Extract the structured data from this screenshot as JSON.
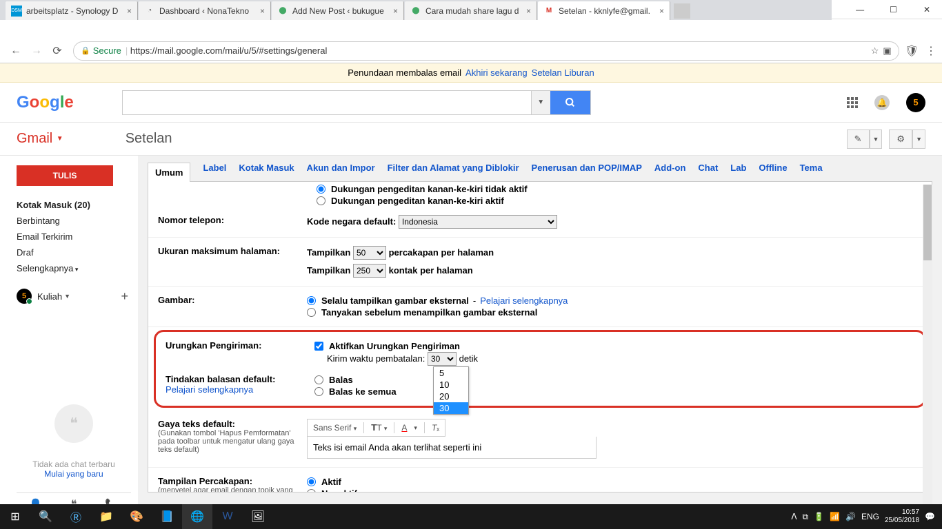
{
  "browser_tabs": [
    {
      "title": "arbeitsplatz - Synology D",
      "favicon": "DSM",
      "favicon_bg": "#0096d6"
    },
    {
      "title": "Dashboard ‹ NonaTekno",
      "favicon": "⬤",
      "favicon_bg": "#333"
    },
    {
      "title": "Add New Post ‹ bukugue",
      "favicon": "⬤",
      "favicon_bg": "#4a6"
    },
    {
      "title": "Cara mudah share lagu d",
      "favicon": "⬤",
      "favicon_bg": "#4a6"
    },
    {
      "title": "Setelan - kknlyfe@gmail.",
      "favicon": "M",
      "favicon_bg": "#d93025",
      "active": true
    }
  ],
  "address": {
    "secure": "Secure",
    "url": "https://mail.google.com/mail/u/5/#settings/general"
  },
  "banner": {
    "text": "Penundaan membalas email",
    "link1": "Akhiri sekarang",
    "link2": "Setelan Liburan"
  },
  "header": {
    "avatar_badge": "5"
  },
  "subheader": {
    "brand": "Gmail",
    "title": "Setelan"
  },
  "sidebar": {
    "compose": "TULIS",
    "items": [
      "Kotak Masuk (20)",
      "Berbintang",
      "Email Terkirim",
      "Draf",
      "Selengkapnya"
    ],
    "label_name": "Kuliah",
    "label_badge": "5",
    "chat_empty": "Tidak ada chat terbaru",
    "chat_start": "Mulai yang baru"
  },
  "tabs": [
    "Umum",
    "Label",
    "Kotak Masuk",
    "Akun dan Impor",
    "Filter dan Alamat yang Diblokir",
    "Penerusan dan POP/IMAP",
    "Add-on",
    "Chat",
    "Lab",
    "Offline",
    "Tema"
  ],
  "settings": {
    "rtl": {
      "off": "Dukungan pengeditan kanan-ke-kiri tidak aktif",
      "on": "Dukungan pengeditan kanan-ke-kiri aktif"
    },
    "phone": {
      "label": "Nomor telepon:",
      "code_label": "Kode negara default:",
      "country": "Indonesia"
    },
    "page_size": {
      "label": "Ukuran maksimum halaman:",
      "show": "Tampilkan",
      "conv_per_page": "percakapan per halaman",
      "conv_value": "50",
      "contacts_value": "250",
      "contacts_per_page": "kontak per halaman"
    },
    "images": {
      "label": "Gambar:",
      "always": "Selalu tampilkan gambar eksternal",
      "learn": "Pelajari selengkapnya",
      "ask": "Tanyakan sebelum menampilkan gambar eksternal"
    },
    "undo": {
      "label": "Urungkan Pengiriman:",
      "enable": "Aktifkan Urungkan Pengiriman",
      "cancel_time": "Kirim waktu pembatalan:",
      "value": "30",
      "seconds": "detik",
      "options": [
        "5",
        "10",
        "20",
        "30"
      ]
    },
    "reply": {
      "label": "Tindakan balasan default:",
      "learn": "Pelajari selengkapnya",
      "reply": "Balas",
      "reply_all": "Balas ke semua"
    },
    "text_style": {
      "label": "Gaya teks default:",
      "hint": "(Gunakan tombol 'Hapus Pemformatan' pada toolbar untuk mengatur ulang gaya teks default)",
      "font": "Sans Serif",
      "sample": "Teks isi email Anda akan terlihat seperti ini"
    },
    "conversation": {
      "label": "Tampilan Percakapan:",
      "hint": "(menyetel agar email dengan topik yang sama digrupkan)",
      "on": "Aktif",
      "off": "Nonaktif"
    }
  },
  "taskbar": {
    "lang": "ENG",
    "time": "10:57",
    "date": "25/05/2018"
  }
}
